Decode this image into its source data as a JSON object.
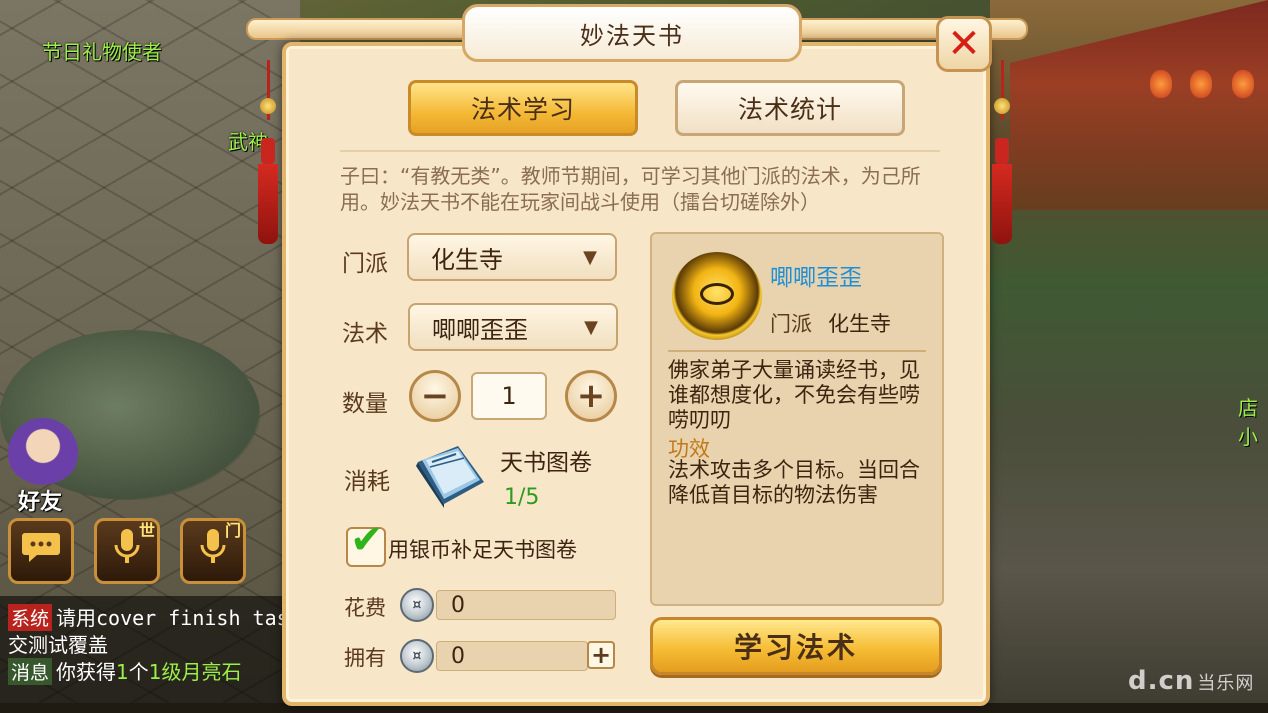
{
  "world": {
    "npc_name": "节日礼物使者",
    "npc_partial": "武神",
    "right_label": "店小"
  },
  "sidebar": {
    "friend_label": "好友",
    "quick_buttons": [
      {
        "icon": "chat-bubble-icon",
        "tag": ""
      },
      {
        "icon": "microphone-icon",
        "tag": "世"
      },
      {
        "icon": "microphone-icon",
        "tag": "门"
      }
    ]
  },
  "chat": {
    "lines": [
      {
        "tag": "系统",
        "text": "请用cover finish tas"
      },
      {
        "tag": "",
        "text": "交测试覆盖"
      },
      {
        "tag": "消息",
        "text_before": "你获得",
        "count": "1",
        "text_mid": "个",
        "item": "1级月亮石"
      }
    ]
  },
  "dialog": {
    "title": "妙法天书",
    "close_label": "✕",
    "tabs": [
      {
        "label": "法术学习",
        "active": true
      },
      {
        "label": "法术统计",
        "active": false
      }
    ],
    "description": "子曰：“有教无类”。教师节期间，可学习其他门派的法术，为己所用。妙法天书不能在玩家间战斗使用（擂台切磋除外）",
    "form": {
      "school_label": "门派",
      "school_value": "化生寺",
      "skill_label": "法术",
      "skill_value": "唧唧歪歪",
      "quantity_label": "数量",
      "quantity_value": "1",
      "minus": "−",
      "plus": "+",
      "consume_label": "消耗",
      "consume_item": "天书图卷",
      "consume_count": "1/5",
      "auto_fill_checked": true,
      "auto_fill_label": "用银币补足天书图卷",
      "cost_label": "花费",
      "cost_value": "0",
      "own_label": "拥有",
      "own_value": "0",
      "own_add": "+"
    },
    "detail": {
      "skill_name": "唧唧歪歪",
      "school_label": "门派",
      "school_value": "化生寺",
      "description": "佛家弟子大量诵读经书，见谁都想度化，不免会有些唠唠叨叨",
      "effect_title": "功效",
      "effect_desc": "法术攻击多个目标。当回合降低首目标的物法伤害"
    },
    "learn_button": "学习法术"
  },
  "watermark": {
    "brand": "d.cn",
    "site": "当乐网"
  },
  "colors": {
    "accent_gold": "#f4b936",
    "skill_name_blue": "#1e8fd6",
    "count_green": "#2e9b1e",
    "effect_orange": "#c07a1c",
    "system_red": "#b8231e"
  }
}
